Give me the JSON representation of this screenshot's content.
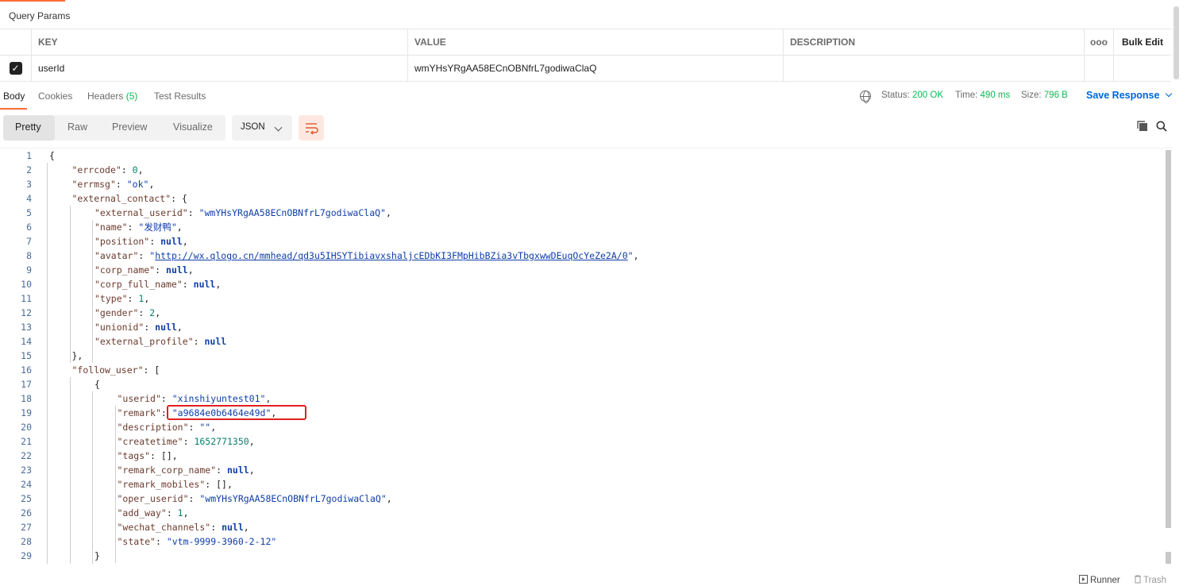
{
  "query_params": {
    "title": "Query Params",
    "headers": {
      "key": "KEY",
      "value": "VALUE",
      "description": "DESCRIPTION",
      "more": "ooo",
      "bulk_edit": "Bulk Edit"
    },
    "rows": [
      {
        "checked": true,
        "key": "userId",
        "value": "wmYHsYRgAA58ECnOBNfrL7godiwaClaQ",
        "description": ""
      }
    ]
  },
  "response_tabs": [
    {
      "label": "Body",
      "active": true
    },
    {
      "label": "Cookies",
      "active": false
    },
    {
      "label": "Headers",
      "count": "(5)",
      "active": false
    },
    {
      "label": "Test Results",
      "active": false
    }
  ],
  "status": {
    "status_label": "Status:",
    "status_value": "200 OK",
    "time_label": "Time:",
    "time_value": "490 ms",
    "size_label": "Size:",
    "size_value": "796 B",
    "save_response": "Save Response"
  },
  "view_modes": [
    {
      "label": "Pretty",
      "active": true
    },
    {
      "label": "Raw",
      "active": false
    },
    {
      "label": "Preview",
      "active": false
    },
    {
      "label": "Visualize",
      "active": false
    }
  ],
  "format_select": "JSON",
  "code_lines": [
    {
      "n": "1",
      "indent": 0,
      "parts": [
        [
          "p",
          "{"
        ]
      ]
    },
    {
      "n": "2",
      "indent": 1,
      "parts": [
        [
          "k",
          "\"errcode\""
        ],
        [
          "p",
          ": "
        ],
        [
          "n",
          "0"
        ],
        [
          "p",
          ","
        ]
      ]
    },
    {
      "n": "3",
      "indent": 1,
      "parts": [
        [
          "k",
          "\"errmsg\""
        ],
        [
          "p",
          ": "
        ],
        [
          "s",
          "\"ok\""
        ],
        [
          "p",
          ","
        ]
      ]
    },
    {
      "n": "4",
      "indent": 1,
      "parts": [
        [
          "k",
          "\"external_contact\""
        ],
        [
          "p",
          ": {"
        ]
      ]
    },
    {
      "n": "5",
      "indent": 2,
      "parts": [
        [
          "k",
          "\"external_userid\""
        ],
        [
          "p",
          ": "
        ],
        [
          "s",
          "\"wmYHsYRgAA58ECnOBNfrL7godiwaClaQ\""
        ],
        [
          "p",
          ","
        ]
      ]
    },
    {
      "n": "6",
      "indent": 2,
      "parts": [
        [
          "k",
          "\"name\""
        ],
        [
          "p",
          ": "
        ],
        [
          "s",
          "\"发财鸭\""
        ],
        [
          "p",
          ","
        ]
      ]
    },
    {
      "n": "7",
      "indent": 2,
      "parts": [
        [
          "k",
          "\"position\""
        ],
        [
          "p",
          ": "
        ],
        [
          "nl",
          "null"
        ],
        [
          "p",
          ","
        ]
      ]
    },
    {
      "n": "8",
      "indent": 2,
      "parts": [
        [
          "k",
          "\"avatar\""
        ],
        [
          "p",
          ": "
        ],
        [
          "s",
          "\""
        ],
        [
          "u",
          "http://wx.qlogo.cn/mmhead/qd3u5IHSYTibiavxshaljcEDbKI3FMpHibBZia3vTbgxwwDEuqOcYeZe2A/0"
        ],
        [
          "s",
          "\""
        ],
        [
          "p",
          ","
        ]
      ]
    },
    {
      "n": "9",
      "indent": 2,
      "parts": [
        [
          "k",
          "\"corp_name\""
        ],
        [
          "p",
          ": "
        ],
        [
          "nl",
          "null"
        ],
        [
          "p",
          ","
        ]
      ]
    },
    {
      "n": "10",
      "indent": 2,
      "parts": [
        [
          "k",
          "\"corp_full_name\""
        ],
        [
          "p",
          ": "
        ],
        [
          "nl",
          "null"
        ],
        [
          "p",
          ","
        ]
      ]
    },
    {
      "n": "11",
      "indent": 2,
      "parts": [
        [
          "k",
          "\"type\""
        ],
        [
          "p",
          ": "
        ],
        [
          "n",
          "1"
        ],
        [
          "p",
          ","
        ]
      ]
    },
    {
      "n": "12",
      "indent": 2,
      "parts": [
        [
          "k",
          "\"gender\""
        ],
        [
          "p",
          ": "
        ],
        [
          "n",
          "2"
        ],
        [
          "p",
          ","
        ]
      ]
    },
    {
      "n": "13",
      "indent": 2,
      "parts": [
        [
          "k",
          "\"unionid\""
        ],
        [
          "p",
          ": "
        ],
        [
          "nl",
          "null"
        ],
        [
          "p",
          ","
        ]
      ]
    },
    {
      "n": "14",
      "indent": 2,
      "parts": [
        [
          "k",
          "\"external_profile\""
        ],
        [
          "p",
          ": "
        ],
        [
          "nl",
          "null"
        ]
      ]
    },
    {
      "n": "15",
      "indent": 1,
      "parts": [
        [
          "p",
          "},"
        ]
      ]
    },
    {
      "n": "16",
      "indent": 1,
      "parts": [
        [
          "k",
          "\"follow_user\""
        ],
        [
          "p",
          ": ["
        ]
      ]
    },
    {
      "n": "17",
      "indent": 2,
      "parts": [
        [
          "p",
          "{"
        ]
      ]
    },
    {
      "n": "18",
      "indent": 3,
      "parts": [
        [
          "k",
          "\"userid\""
        ],
        [
          "p",
          ": "
        ],
        [
          "s",
          "\"xinshiyuntest01\""
        ],
        [
          "p",
          ","
        ]
      ]
    },
    {
      "n": "19",
      "indent": 3,
      "parts": [
        [
          "k",
          "\"remark\""
        ],
        [
          "p",
          ": "
        ],
        [
          "s",
          "\"a9684e0b6464e49d\""
        ],
        [
          "p",
          ","
        ]
      ]
    },
    {
      "n": "20",
      "indent": 3,
      "parts": [
        [
          "k",
          "\"description\""
        ],
        [
          "p",
          ": "
        ],
        [
          "s",
          "\"\""
        ],
        [
          "p",
          ","
        ]
      ]
    },
    {
      "n": "21",
      "indent": 3,
      "parts": [
        [
          "k",
          "\"createtime\""
        ],
        [
          "p",
          ": "
        ],
        [
          "n",
          "1652771350"
        ],
        [
          "p",
          ","
        ]
      ]
    },
    {
      "n": "22",
      "indent": 3,
      "parts": [
        [
          "k",
          "\"tags\""
        ],
        [
          "p",
          ": [],"
        ]
      ]
    },
    {
      "n": "23",
      "indent": 3,
      "parts": [
        [
          "k",
          "\"remark_corp_name\""
        ],
        [
          "p",
          ": "
        ],
        [
          "nl",
          "null"
        ],
        [
          "p",
          ","
        ]
      ]
    },
    {
      "n": "24",
      "indent": 3,
      "parts": [
        [
          "k",
          "\"remark_mobiles\""
        ],
        [
          "p",
          ": [],"
        ]
      ]
    },
    {
      "n": "25",
      "indent": 3,
      "parts": [
        [
          "k",
          "\"oper_userid\""
        ],
        [
          "p",
          ": "
        ],
        [
          "s",
          "\"wmYHsYRgAA58ECnOBNfrL7godiwaClaQ\""
        ],
        [
          "p",
          ","
        ]
      ]
    },
    {
      "n": "26",
      "indent": 3,
      "parts": [
        [
          "k",
          "\"add_way\""
        ],
        [
          "p",
          ": "
        ],
        [
          "n",
          "1"
        ],
        [
          "p",
          ","
        ]
      ]
    },
    {
      "n": "27",
      "indent": 3,
      "parts": [
        [
          "k",
          "\"wechat_channels\""
        ],
        [
          "p",
          ": "
        ],
        [
          "nl",
          "null"
        ],
        [
          "p",
          ","
        ]
      ]
    },
    {
      "n": "28",
      "indent": 3,
      "parts": [
        [
          "k",
          "\"state\""
        ],
        [
          "p",
          ": "
        ],
        [
          "s",
          "\"vtm-9999-3960-2-12\""
        ]
      ]
    },
    {
      "n": "29",
      "indent": 2,
      "parts": [
        [
          "p",
          "}"
        ]
      ]
    }
  ],
  "bottom": {
    "runner": "Runner",
    "trash": "Trash"
  }
}
